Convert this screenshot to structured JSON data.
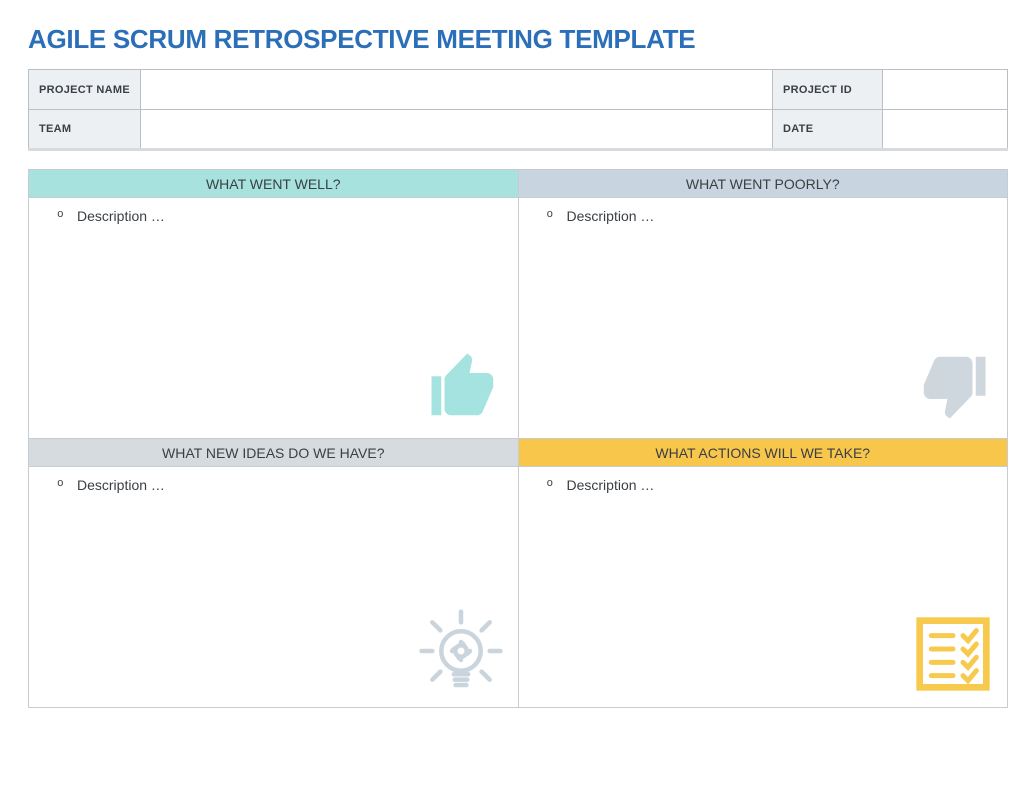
{
  "title": "AGILE SCRUM RETROSPECTIVE MEETING TEMPLATE",
  "info": {
    "project_name_label": "PROJECT NAME",
    "project_name_value": "",
    "project_id_label": "PROJECT ID",
    "project_id_value": "",
    "team_label": "TEAM",
    "team_value": "",
    "date_label": "DATE",
    "date_value": ""
  },
  "quadrants": {
    "went_well": {
      "header": "WHAT WENT WELL?",
      "bullet": "Description …"
    },
    "went_poorly": {
      "header": "WHAT WENT POORLY?",
      "bullet": "Description …"
    },
    "new_ideas": {
      "header": "WHAT NEW IDEAS DO WE HAVE?",
      "bullet": "Description …"
    },
    "actions": {
      "header": "WHAT ACTIONS WILL WE TAKE?",
      "bullet": "Description …"
    }
  },
  "colors": {
    "title": "#2b6fb8",
    "teal": "#a8e2df",
    "bluegray": "#c8d4df",
    "gray": "#d6dbdf",
    "yellow": "#f8c64b",
    "thumb_up": "#a5e3e0",
    "thumb_down": "#cfd7de",
    "bulb": "#c9d4dc",
    "checklist": "#f7c94d"
  }
}
